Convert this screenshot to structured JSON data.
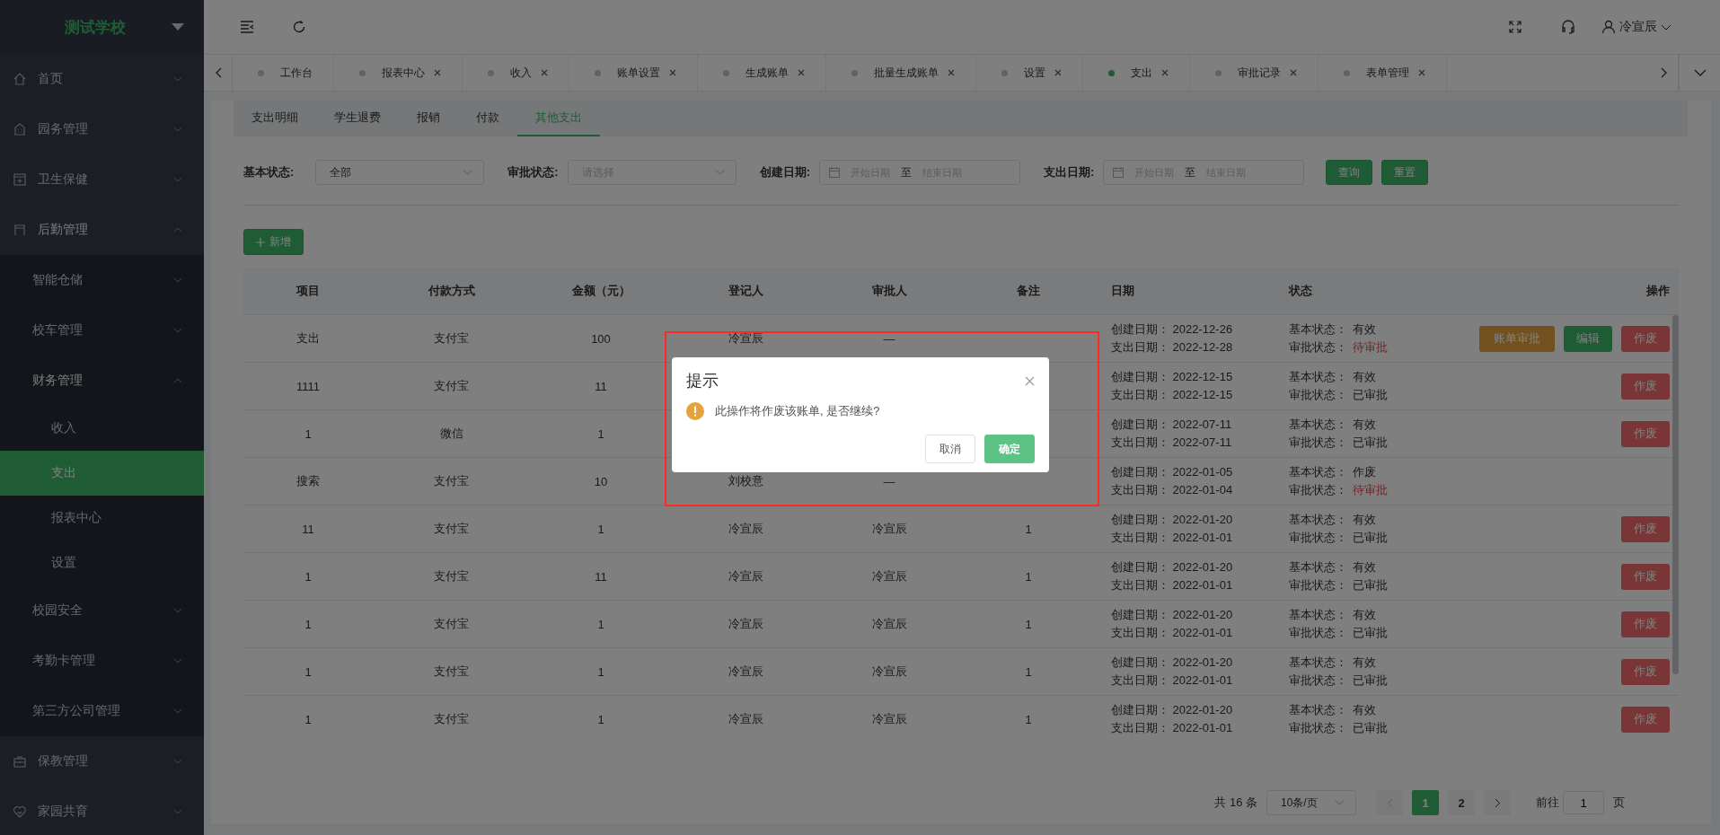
{
  "sidebar": {
    "logo": "测试学校",
    "menu": [
      {
        "label": "首页",
        "expanded": false,
        "selected": false
      },
      {
        "label": "园务管理",
        "expanded": false,
        "selected": false
      },
      {
        "label": "卫生保健",
        "expanded": false,
        "selected": false
      },
      {
        "label": "后勤管理",
        "expanded": true,
        "selected": false,
        "children": [
          {
            "label": "智能仓储",
            "expanded": false,
            "selected": false
          },
          {
            "label": "校车管理",
            "expanded": false,
            "selected": false
          },
          {
            "label": "财务管理",
            "expanded": true,
            "selected": false,
            "children": [
              {
                "label": "收入",
                "selected": false
              },
              {
                "label": "支出",
                "selected": true
              },
              {
                "label": "报表中心",
                "selected": false
              },
              {
                "label": "设置",
                "selected": false
              }
            ]
          },
          {
            "label": "校园安全",
            "expanded": false,
            "selected": false
          },
          {
            "label": "考勤卡管理",
            "expanded": false,
            "selected": false
          },
          {
            "label": "第三方公司管理",
            "expanded": false,
            "selected": false
          }
        ]
      },
      {
        "label": "保教管理",
        "expanded": false,
        "selected": false
      },
      {
        "label": "家园共育",
        "expanded": false,
        "selected": false
      }
    ]
  },
  "header": {
    "user": "冷宣辰"
  },
  "tabs": [
    {
      "label": "工作台",
      "closable": false,
      "selected": false
    },
    {
      "label": "报表中心",
      "closable": true,
      "selected": false
    },
    {
      "label": "收入",
      "closable": true,
      "selected": false
    },
    {
      "label": "账单设置",
      "closable": true,
      "selected": false
    },
    {
      "label": "生成账单",
      "closable": true,
      "selected": false
    },
    {
      "label": "批量生成账单",
      "closable": true,
      "selected": false
    },
    {
      "label": "设置",
      "closable": true,
      "selected": false
    },
    {
      "label": "支出",
      "closable": true,
      "selected": true
    },
    {
      "label": "审批记录",
      "closable": true,
      "selected": false
    },
    {
      "label": "表单管理",
      "closable": true,
      "selected": false
    }
  ],
  "subtabs": [
    {
      "label": "支出明细",
      "selected": false
    },
    {
      "label": "学生退费",
      "selected": false
    },
    {
      "label": "报销",
      "selected": false
    },
    {
      "label": "付款",
      "selected": false
    },
    {
      "label": "其他支出",
      "selected": true
    }
  ],
  "filters": [
    {
      "kind": "select",
      "label": "基本状态:",
      "value": "全部"
    },
    {
      "kind": "select",
      "label": "审批状态:",
      "placeholder": "请选择"
    },
    {
      "kind": "daterange",
      "label": "创建日期:",
      "start": "开始日期",
      "separator": "至",
      "end": "结束日期"
    },
    {
      "kind": "daterange",
      "label": "支出日期:",
      "start": "开始日期",
      "separator": "至",
      "end": "结束日期"
    }
  ],
  "filter_buttons": [
    "查询",
    "重置"
  ],
  "add_button": "新增",
  "table": {
    "columns": [
      "项目",
      "付款方式",
      "金额（元）",
      "登记人",
      "审批人",
      "备注",
      "日期",
      "状态",
      "操作"
    ],
    "rows": [
      {
        "item": "支出",
        "payment": "支付宝",
        "amount": "100",
        "registrar": "冷宣辰",
        "approver": "—",
        "dates": [
          {
            "label": "创建日期：",
            "value": "2022-12-26"
          },
          {
            "label": "支出日期：",
            "value": "2022-12-28"
          }
        ],
        "statuses": [
          {
            "label": "基本状态：",
            "value": "有效",
            "alert": false
          },
          {
            "label": "审批状态：",
            "value": "待审批",
            "alert": true
          }
        ],
        "actions": [
          {
            "kind": "warning",
            "label": "账单审批"
          },
          {
            "kind": "primary",
            "label": "编辑"
          },
          {
            "kind": "danger",
            "label": "作废"
          }
        ]
      },
      {
        "item": "1111",
        "payment": "支付宝",
        "amount": "11",
        "dates": [
          {
            "label": "创建日期：",
            "value": "2022-12-15"
          },
          {
            "label": "支出日期：",
            "value": "2022-12-15"
          }
        ],
        "statuses": [
          {
            "label": "基本状态：",
            "value": "有效",
            "alert": false
          },
          {
            "label": "审批状态：",
            "value": "已审批",
            "alert": false
          }
        ],
        "actions": [
          {
            "kind": "danger",
            "label": "作废"
          }
        ]
      },
      {
        "item": "1",
        "payment": "微信",
        "amount": "1",
        "dates": [
          {
            "label": "创建日期：",
            "value": "2022-07-11"
          },
          {
            "label": "支出日期：",
            "value": "2022-07-11"
          }
        ],
        "statuses": [
          {
            "label": "基本状态：",
            "value": "有效",
            "alert": false
          },
          {
            "label": "审批状态：",
            "value": "已审批",
            "alert": false
          }
        ],
        "actions": [
          {
            "kind": "danger",
            "label": "作废"
          }
        ]
      },
      {
        "item": "搜索",
        "payment": "支付宝",
        "amount": "10",
        "registrar": "刘校意",
        "approver": "—",
        "dates": [
          {
            "label": "创建日期：",
            "value": "2022-01-05"
          },
          {
            "label": "支出日期：",
            "value": "2022-01-04"
          }
        ],
        "statuses": [
          {
            "label": "基本状态：",
            "value": "作废",
            "alert": false
          },
          {
            "label": "审批状态：",
            "value": "待审批",
            "alert": true
          }
        ]
      },
      {
        "item": "11",
        "payment": "支付宝",
        "amount": "1",
        "registrar": "冷宣辰",
        "approver": "冷宣辰",
        "remark": "1",
        "dates": [
          {
            "label": "创建日期：",
            "value": "2022-01-20"
          },
          {
            "label": "支出日期：",
            "value": "2022-01-01"
          }
        ],
        "statuses": [
          {
            "label": "基本状态：",
            "value": "有效",
            "alert": false
          },
          {
            "label": "审批状态：",
            "value": "已审批",
            "alert": false
          }
        ],
        "actions": [
          {
            "kind": "danger",
            "label": "作废"
          }
        ]
      },
      {
        "item": "1",
        "payment": "支付宝",
        "amount": "11",
        "registrar": "冷宣辰",
        "approver": "冷宣辰",
        "remark": "1",
        "dates": [
          {
            "label": "创建日期：",
            "value": "2022-01-20"
          },
          {
            "label": "支出日期：",
            "value": "2022-01-01"
          }
        ],
        "statuses": [
          {
            "label": "基本状态：",
            "value": "有效",
            "alert": false
          },
          {
            "label": "审批状态：",
            "value": "已审批",
            "alert": false
          }
        ],
        "actions": [
          {
            "kind": "danger",
            "label": "作废"
          }
        ]
      },
      {
        "item": "1",
        "payment": "支付宝",
        "amount": "1",
        "registrar": "冷宣辰",
        "approver": "冷宣辰",
        "remark": "1",
        "dates": [
          {
            "label": "创建日期：",
            "value": "2022-01-20"
          },
          {
            "label": "支出日期：",
            "value": "2022-01-01"
          }
        ],
        "statuses": [
          {
            "label": "基本状态：",
            "value": "有效",
            "alert": false
          },
          {
            "label": "审批状态：",
            "value": "已审批",
            "alert": false
          }
        ],
        "actions": [
          {
            "kind": "danger",
            "label": "作废"
          }
        ]
      },
      {
        "item": "1",
        "payment": "支付宝",
        "amount": "1",
        "registrar": "冷宣辰",
        "approver": "冷宣辰",
        "remark": "1",
        "dates": [
          {
            "label": "创建日期：",
            "value": "2022-01-20"
          },
          {
            "label": "支出日期：",
            "value": "2022-01-01"
          }
        ],
        "statuses": [
          {
            "label": "基本状态：",
            "value": "有效",
            "alert": false
          },
          {
            "label": "审批状态：",
            "value": "已审批",
            "alert": false
          }
        ],
        "actions": [
          {
            "kind": "danger",
            "label": "作废"
          }
        ]
      },
      {
        "item": "1",
        "payment": "支付宝",
        "amount": "1",
        "registrar": "冷宣辰",
        "approver": "冷宣辰",
        "remark": "1",
        "dates": [
          {
            "label": "创建日期：",
            "value": "2022-01-20"
          },
          {
            "label": "支出日期：",
            "value": "2022-01-01"
          }
        ],
        "statuses": [
          {
            "label": "基本状态：",
            "value": "有效",
            "alert": false
          },
          {
            "label": "审批状态：",
            "value": "已审批",
            "alert": false
          }
        ],
        "actions": [
          {
            "kind": "danger",
            "label": "作废"
          }
        ]
      }
    ]
  },
  "pagination": {
    "total": "共 16 条",
    "page_size": "10条/页",
    "pages": [
      {
        "label": "1",
        "selected": true
      },
      {
        "label": "2",
        "selected": false
      }
    ],
    "goto_label": "前往",
    "goto_value": "1",
    "goto_suffix": "页"
  },
  "dialog": {
    "title": "提示",
    "message": "此操作将作废该账单, 是否继续?",
    "buttons": [
      {
        "kind": "cancel",
        "label": "取消"
      },
      {
        "kind": "confirm",
        "label": "确定"
      }
    ]
  }
}
